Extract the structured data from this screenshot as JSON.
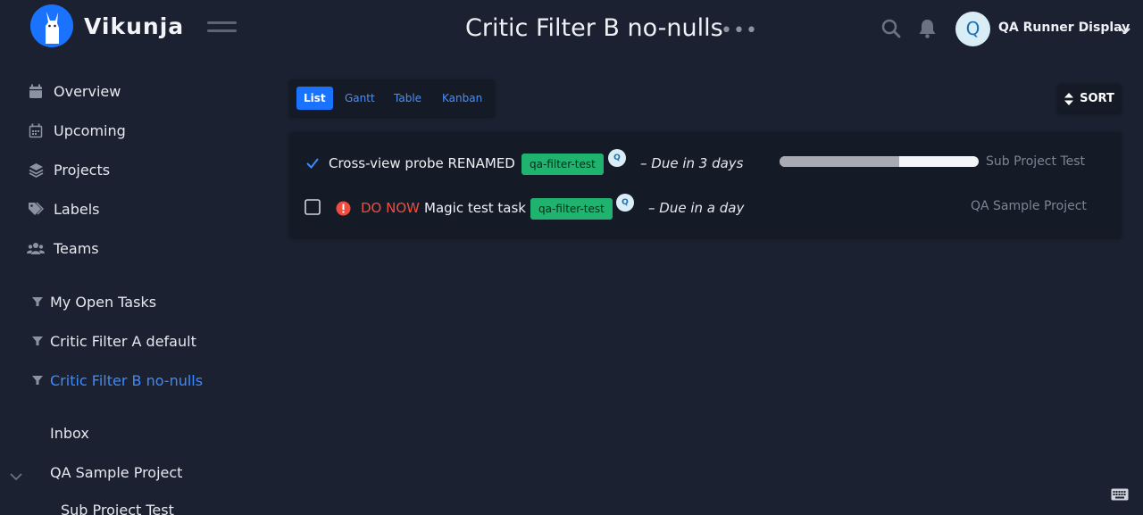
{
  "app": {
    "name": "Vikunja"
  },
  "header": {
    "title": "Critic Filter B no-nulls",
    "more_label": "•••",
    "user": {
      "initial": "Q",
      "name": "QA Runner Display"
    }
  },
  "sidebar": {
    "nav": [
      {
        "label": "Overview",
        "icon": "calendar-icon"
      },
      {
        "label": "Upcoming",
        "icon": "calendar-grid-icon"
      },
      {
        "label": "Projects",
        "icon": "layers-icon"
      },
      {
        "label": "Labels",
        "icon": "tags-icon"
      },
      {
        "label": "Teams",
        "icon": "users-icon"
      }
    ],
    "filters": [
      {
        "label": "My Open Tasks",
        "active": false
      },
      {
        "label": "Critic Filter A default",
        "active": false
      },
      {
        "label": "Critic Filter B no-nulls",
        "active": true
      }
    ],
    "projects": [
      {
        "label": "Inbox"
      },
      {
        "label": "QA Sample Project"
      },
      {
        "label": "Sub Project Test"
      }
    ]
  },
  "views": [
    {
      "label": "List",
      "active": true
    },
    {
      "label": "Gantt",
      "active": false
    },
    {
      "label": "Table",
      "active": false
    },
    {
      "label": "Kanban",
      "active": false
    }
  ],
  "sort": {
    "label": "SORT"
  },
  "tasks": [
    {
      "done": true,
      "priority_label": "",
      "title": "Cross-view probe RENAMED",
      "label": "qa-filter-test",
      "assignee_initial": "Q",
      "due": "– Due in 3 days",
      "percent_done": 0.6,
      "project": "Sub Project Test"
    },
    {
      "done": false,
      "priority_label": "DO NOW",
      "title": "Magic test task",
      "label": "qa-filter-test",
      "assignee_initial": "Q",
      "due": "– Due in a day",
      "project": "QA Sample Project"
    }
  ],
  "colors": {
    "background": "#1b2130",
    "accent": "#1973ff",
    "label": "#1fb36f",
    "priority": "#f14d3f"
  }
}
